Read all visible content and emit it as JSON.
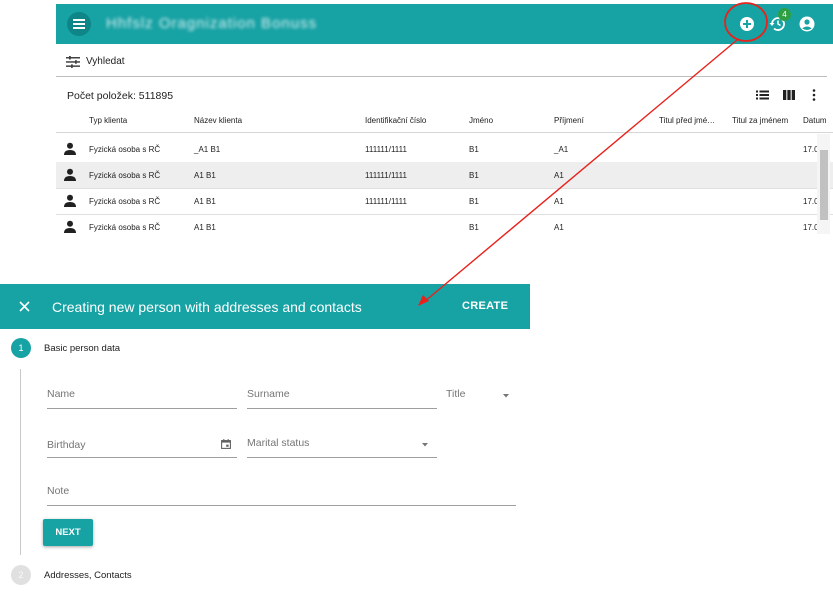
{
  "app_bar": {
    "title": "Hhfslz Oragnization Bonuss",
    "notifications_count": "4"
  },
  "toolbar": {
    "search_label": "Vyhledat"
  },
  "list": {
    "count_label": "Počet položek: 511895",
    "columns": [
      "Typ klienta",
      "Název klienta",
      "Identifikační číslo",
      "Jméno",
      "Příjmení",
      "Titul před jmé…",
      "Titul za jménem",
      "Datum"
    ],
    "rows": [
      {
        "type": "Fyzická osoba s RČ",
        "name": "_A1 B1",
        "id": "111111/1111",
        "first": "B1",
        "last": "_A1",
        "date": "17.0"
      },
      {
        "type": "Fyzická osoba s RČ",
        "name": "A1 B1",
        "id": "111111/1111",
        "first": "B1",
        "last": "A1",
        "date": ""
      },
      {
        "type": "Fyzická osoba s RČ",
        "name": "A1 B1",
        "id": "111111/1111",
        "first": "B1",
        "last": "A1",
        "date": "17.0"
      },
      {
        "type": "Fyzická osoba s RČ",
        "name": "A1 B1",
        "id": "",
        "first": "B1",
        "last": "A1",
        "date": "17.0"
      }
    ]
  },
  "dialog": {
    "title": "Creating new person with addresses and contacts",
    "create_label": "CREATE",
    "steps": [
      {
        "number": "1",
        "label": "Basic person data"
      },
      {
        "number": "2",
        "label": "Addresses, Contacts"
      }
    ],
    "fields": {
      "name": "Name",
      "surname": "Surname",
      "title": "Title",
      "birthday": "Birthday",
      "marital_status": "Marital status",
      "note": "Note"
    },
    "next_label": "NEXT"
  },
  "colors": {
    "primary": "#17a2a4",
    "annotation": "#e8221b",
    "badge": "#2ea043"
  }
}
